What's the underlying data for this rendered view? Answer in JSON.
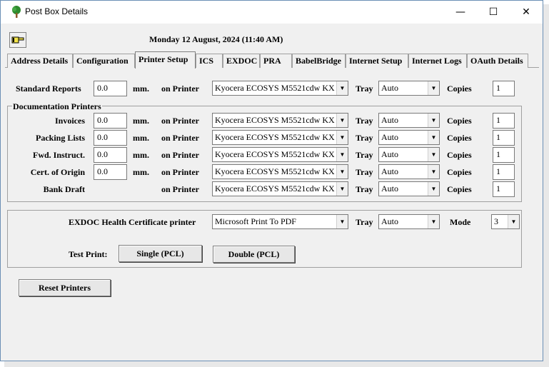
{
  "window": {
    "title": "Post Box Details"
  },
  "header": {
    "datetime": "Monday 12 August, 2024  (11:40 AM)"
  },
  "tabs": [
    {
      "label": "Address Details"
    },
    {
      "label": "Configuration"
    },
    {
      "label": "Printer Setup"
    },
    {
      "label": "ICS"
    },
    {
      "label": "EXDOC"
    },
    {
      "label": "PRA"
    },
    {
      "label": "BabelBridge"
    },
    {
      "label": "Internet Setup"
    },
    {
      "label": "Internet Logs"
    },
    {
      "label": "OAuth Details"
    }
  ],
  "labels": {
    "mm": "mm.",
    "on_printer": "on Printer",
    "tray": "Tray",
    "copies": "Copies"
  },
  "standard": {
    "label": "Standard Reports",
    "margin": "0.0",
    "printer": "Kyocera ECOSYS M5521cdw KX",
    "tray": "Auto",
    "copies": "1"
  },
  "documentation": {
    "title": "Documentation Printers",
    "rows": [
      {
        "label": "Invoices",
        "margin": "0.0",
        "printer": "Kyocera ECOSYS M5521cdw KX",
        "tray": "Auto",
        "copies": "1"
      },
      {
        "label": "Packing Lists",
        "margin": "0.0",
        "printer": "Kyocera ECOSYS M5521cdw KX",
        "tray": "Auto",
        "copies": "1"
      },
      {
        "label": "Fwd. Instruct.",
        "margin": "0.0",
        "printer": "Kyocera ECOSYS M5521cdw KX",
        "tray": "Auto",
        "copies": "1"
      },
      {
        "label": "Cert. of Origin",
        "margin": "0.0",
        "printer": "Kyocera ECOSYS M5521cdw KX",
        "tray": "Auto",
        "copies": "1"
      },
      {
        "label": "Bank Draft",
        "printer": "Kyocera ECOSYS M5521cdw KX",
        "tray": "Auto",
        "copies": "1"
      }
    ]
  },
  "exdoc": {
    "label": "EXDOC Health Certificate printer",
    "printer": "Microsoft Print To PDF",
    "tray": "Auto",
    "mode_label": "Mode",
    "mode": "3",
    "test_print_label": "Test Print:",
    "single_label": "Single (PCL)",
    "double_label": "Double (PCL)"
  },
  "reset_label": "Reset Printers"
}
